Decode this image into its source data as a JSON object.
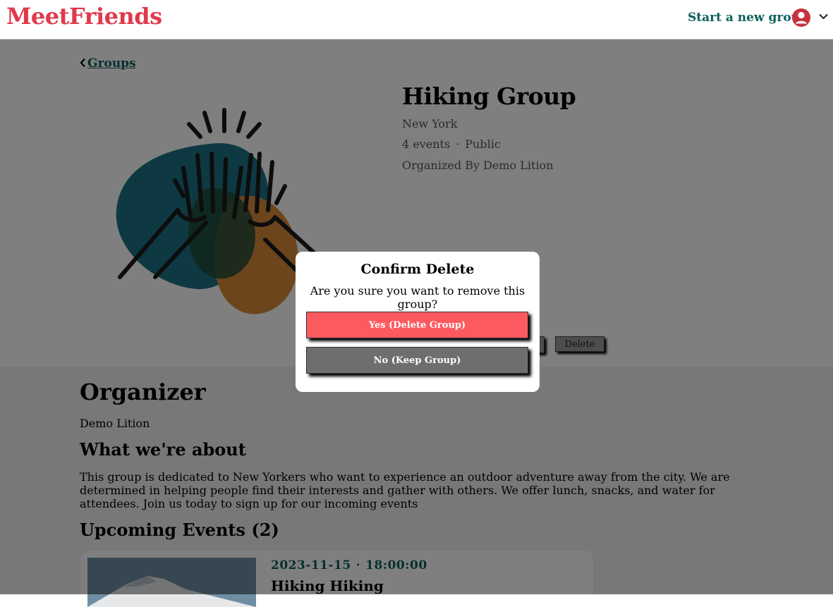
{
  "header": {
    "logo": "MeetFriends",
    "start_group": "Start a new group",
    "user_icon": "user-circle-icon",
    "menu_icon": "chevron-down-icon"
  },
  "back_link": "Groups",
  "group": {
    "name": "Hiking Group",
    "location": "New York",
    "events_count": "4 events",
    "separator": "·",
    "privacy": "Public",
    "organized_by": "Organized By Demo Lition",
    "delete_label": "Delete"
  },
  "organizer": {
    "heading": "Organizer",
    "name": "Demo Lition"
  },
  "about": {
    "heading": "What we're about",
    "text": "This group is dedicated to New Yorkers who want to experience an outdoor adventure away from the city. We are determined in helping people find their interests and gather with others. We offer lunch, snacks, and water for attendees. Join us today to sign up for our incoming events"
  },
  "upcoming": {
    "heading": "Upcoming Events (2)",
    "events": [
      {
        "date": "2023-11-15",
        "separator": "·",
        "time": "18:00:00",
        "name": "Hiking Hiking"
      }
    ]
  },
  "modal": {
    "title": "Confirm Delete",
    "message": "Are you sure you want to remove this group?",
    "yes_label": "Yes (Delete Group)",
    "no_label": "No (Keep Group)"
  },
  "colors": {
    "brand": "#e0394b",
    "accent_teal": "#0b5f5b",
    "danger": "#fd5a5f",
    "neutral_button": "#6e6e6e"
  }
}
